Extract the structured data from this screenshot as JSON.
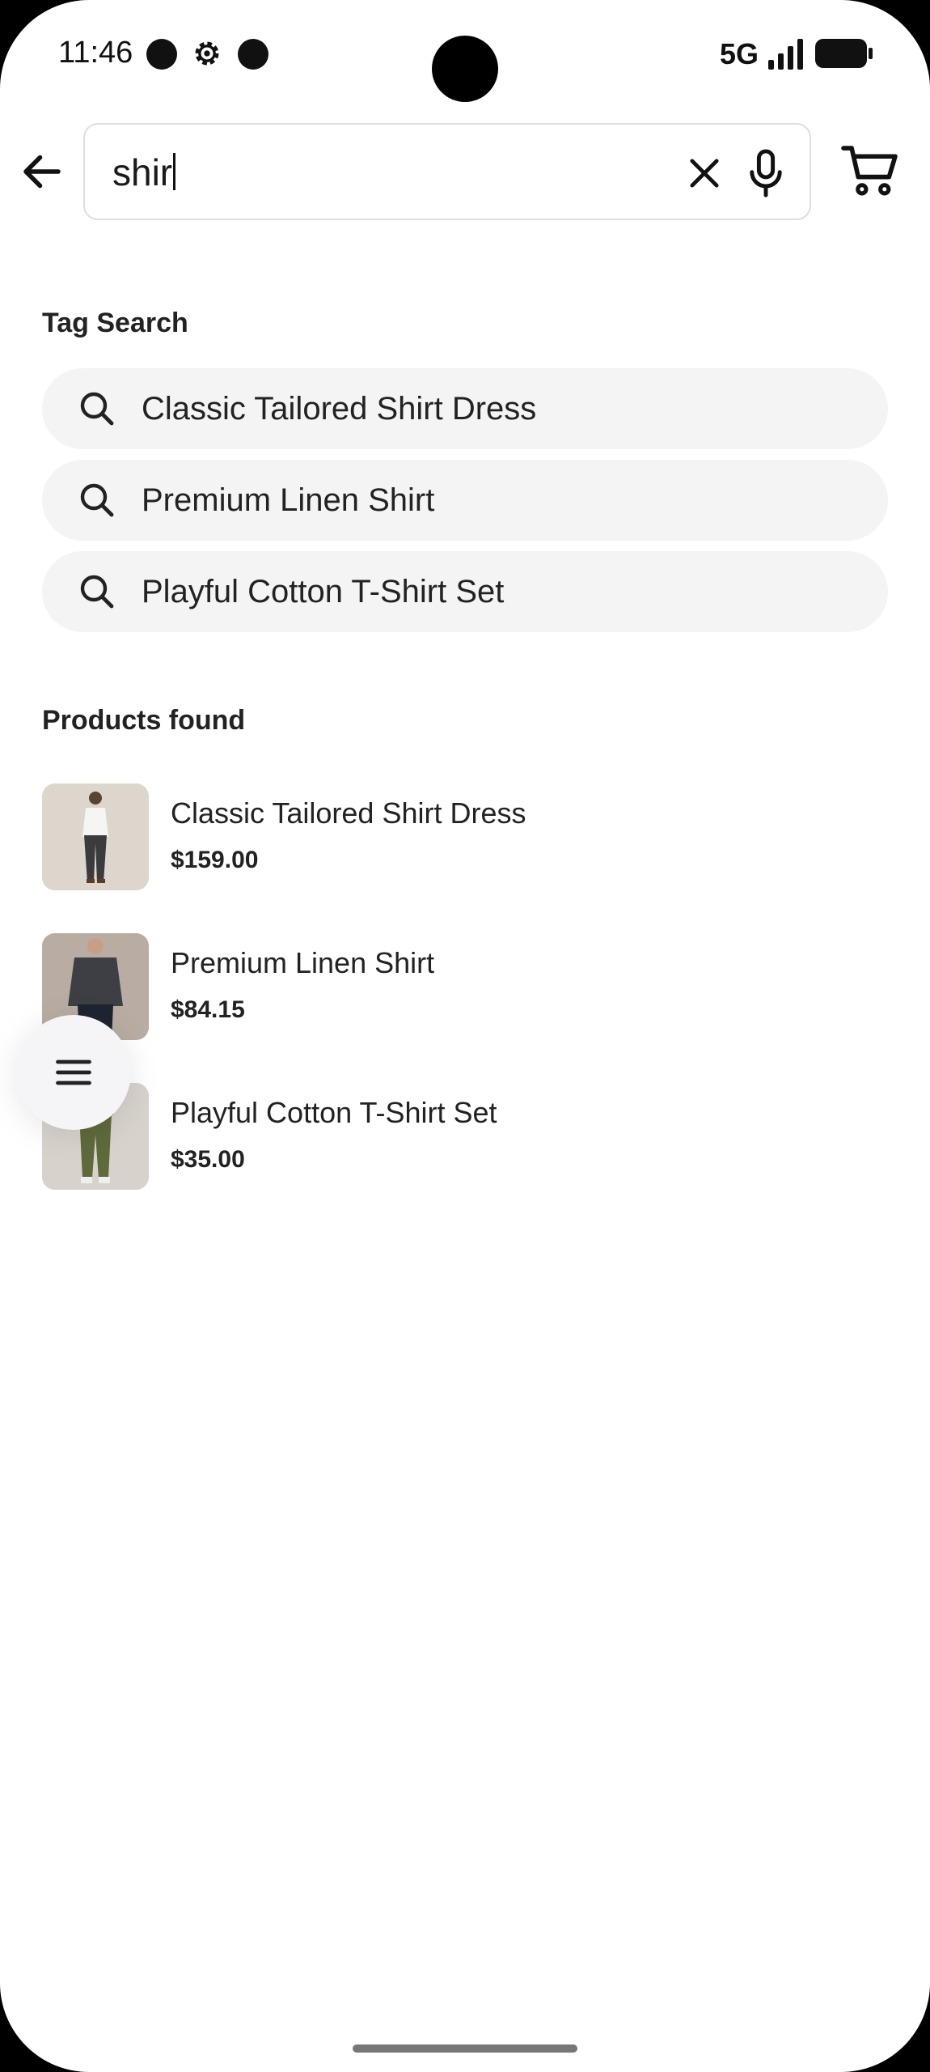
{
  "status_bar": {
    "time": "11:46",
    "network": "5G"
  },
  "search": {
    "query": "shir"
  },
  "tag_search": {
    "title": "Tag Search",
    "items": [
      {
        "label": "Classic Tailored Shirt Dress"
      },
      {
        "label": "Premium Linen Shirt"
      },
      {
        "label": "Playful Cotton T-Shirt Set"
      }
    ]
  },
  "products": {
    "title": "Products found",
    "items": [
      {
        "name": "Classic Tailored Shirt Dress",
        "price": "$159.00"
      },
      {
        "name": "Premium Linen Shirt",
        "price": "$84.15"
      },
      {
        "name": "Playful Cotton T-Shirt Set",
        "price": "$35.00"
      }
    ]
  },
  "icons": {
    "back": "arrow-left-icon",
    "clear": "close-icon",
    "mic": "microphone-icon",
    "cart": "shopping-cart-icon",
    "search": "search-icon",
    "menu": "hamburger-menu-icon"
  }
}
